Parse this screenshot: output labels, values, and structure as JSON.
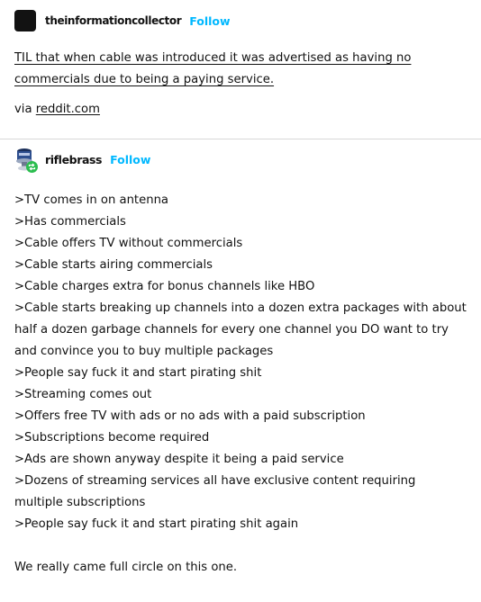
{
  "post1": {
    "username": "theinformationcollector",
    "follow_label": "Follow",
    "title": "TIL that when cable was introduced it was advertised as having no commercials due to being a paying service.",
    "via_prefix": "via",
    "via_link": "reddit.com"
  },
  "post2": {
    "username": "riflebrass",
    "follow_label": "Follow",
    "lines": [
      ">TV comes in on antenna",
      ">Has commercials",
      ">Cable offers TV without commercials",
      ">Cable starts airing commercials",
      ">Cable charges extra for bonus channels like HBO",
      ">Cable starts breaking up channels into a dozen extra packages with about half a dozen garbage channels for every one channel you DO want to try and convince you to buy multiple packages",
      ">People say fuck it and start pirating shit",
      ">Streaming comes out",
      ">Offers free TV with ads or no ads with a paid subscription",
      ">Subscriptions become required",
      ">Ads are shown anyway despite it being a paid service",
      ">Dozens of streaming services all have exclusive content requiring multiple subscriptions",
      ">People say fuck it and start pirating shit again"
    ],
    "closing": "We really came full circle on this one."
  },
  "colors": {
    "follow": "#00b8ff",
    "reblog_badge": "#2bbd4f",
    "divider": "#d8d8d8"
  },
  "icons": {
    "reblog": "reblog-icon"
  }
}
